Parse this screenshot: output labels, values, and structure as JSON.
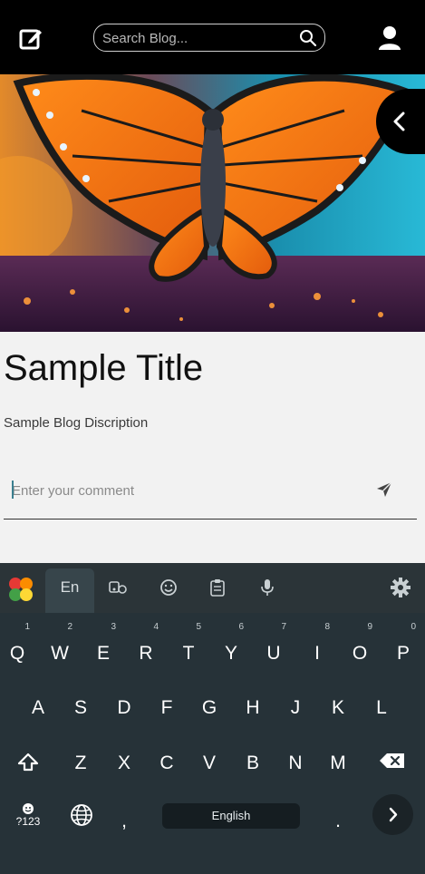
{
  "header": {
    "search_placeholder": "Search Blog...",
    "icons": [
      "edit-icon",
      "search-icon",
      "user-icon"
    ]
  },
  "post": {
    "title": "Sample Title",
    "description": "Sample Blog Discription",
    "comment_placeholder": "Enter your comment"
  },
  "keyboard": {
    "language_tab": "En",
    "space_label": "English",
    "symbols_label": "?123",
    "row1": [
      {
        "letter": "Q",
        "num": "1"
      },
      {
        "letter": "W",
        "num": "2"
      },
      {
        "letter": "E",
        "num": "3"
      },
      {
        "letter": "R",
        "num": "4"
      },
      {
        "letter": "T",
        "num": "5"
      },
      {
        "letter": "Y",
        "num": "6"
      },
      {
        "letter": "U",
        "num": "7"
      },
      {
        "letter": "I",
        "num": "8"
      },
      {
        "letter": "O",
        "num": "9"
      },
      {
        "letter": "P",
        "num": "0"
      }
    ],
    "row2": [
      "A",
      "S",
      "D",
      "F",
      "G",
      "H",
      "J",
      "K",
      "L"
    ],
    "row3": [
      "Z",
      "X",
      "C",
      "V",
      "B",
      "N",
      "M"
    ],
    "comma": ",",
    "period": "."
  },
  "colors": {
    "header_bg": "#000000",
    "page_bg": "#f2f2f2",
    "keyboard_bg": "#263238"
  }
}
